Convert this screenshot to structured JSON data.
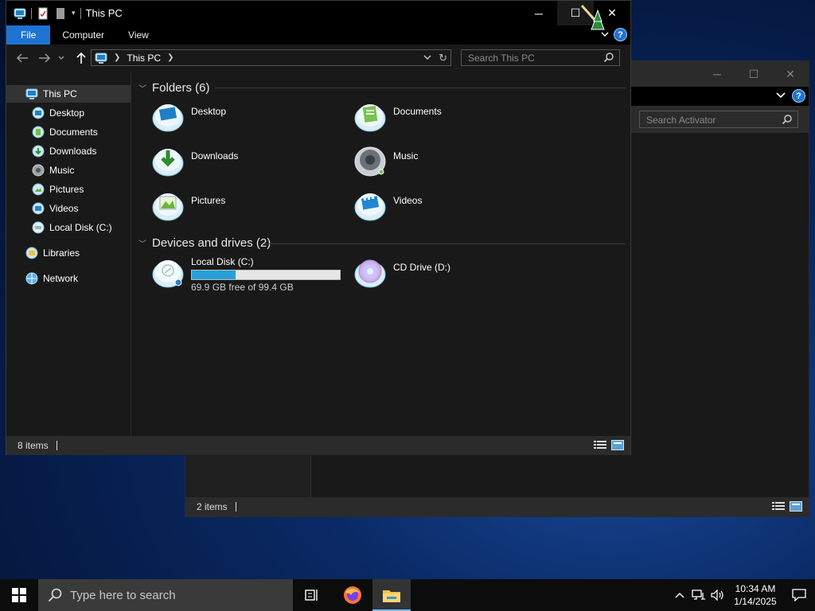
{
  "bg_window": {
    "search_placeholder": "Search Activator",
    "status": {
      "items": "2 items"
    }
  },
  "window": {
    "title": "This PC",
    "controls": {
      "minimize": "─",
      "maximize": "☐",
      "close": "✕"
    },
    "ribbon": {
      "tabs": [
        {
          "label": "File"
        },
        {
          "label": "Computer"
        },
        {
          "label": "View"
        }
      ],
      "help_label": "?"
    },
    "address": {
      "crumb": "This PC",
      "search_placeholder": "Search This PC"
    },
    "nav": {
      "items": [
        {
          "label": "This PC",
          "icon": "this-pc-icon"
        },
        {
          "label": "Desktop",
          "icon": "desktop-icon"
        },
        {
          "label": "Documents",
          "icon": "documents-icon"
        },
        {
          "label": "Downloads",
          "icon": "downloads-icon"
        },
        {
          "label": "Music",
          "icon": "music-icon"
        },
        {
          "label": "Pictures",
          "icon": "pictures-icon"
        },
        {
          "label": "Videos",
          "icon": "videos-icon"
        },
        {
          "label": "Local Disk (C:)",
          "icon": "local-disk-icon"
        },
        {
          "label": "Libraries",
          "icon": "libraries-icon"
        },
        {
          "label": "Network",
          "icon": "network-icon"
        }
      ]
    },
    "groups": {
      "folders": {
        "header": "Folders (6)",
        "items": [
          {
            "label": "Desktop",
            "icon": "desktop-folder-icon"
          },
          {
            "label": "Documents",
            "icon": "documents-folder-icon"
          },
          {
            "label": "Downloads",
            "icon": "downloads-folder-icon"
          },
          {
            "label": "Music",
            "icon": "music-folder-icon"
          },
          {
            "label": "Pictures",
            "icon": "pictures-folder-icon"
          },
          {
            "label": "Videos",
            "icon": "videos-folder-icon"
          }
        ]
      },
      "drives": {
        "header": "Devices and drives (2)",
        "items": [
          {
            "label": "Local Disk (C:)",
            "free_text": "69.9 GB free of 99.4 GB",
            "used_fraction": 0.297,
            "icon": "hard-drive-icon"
          },
          {
            "label": "CD Drive (D:)",
            "icon": "cd-drive-icon"
          }
        ]
      }
    },
    "status": {
      "items": "8 items"
    }
  },
  "taskbar": {
    "search_placeholder": "Type here to search",
    "clock": {
      "time": "10:34 AM",
      "date": "1/14/2025"
    }
  },
  "colors": {
    "accent": "#1e73d2",
    "progress": "#26a0da",
    "window_bg": "#191919",
    "titlebar_bg": "#000000",
    "taskbar_bg": "#0c0c0c"
  }
}
